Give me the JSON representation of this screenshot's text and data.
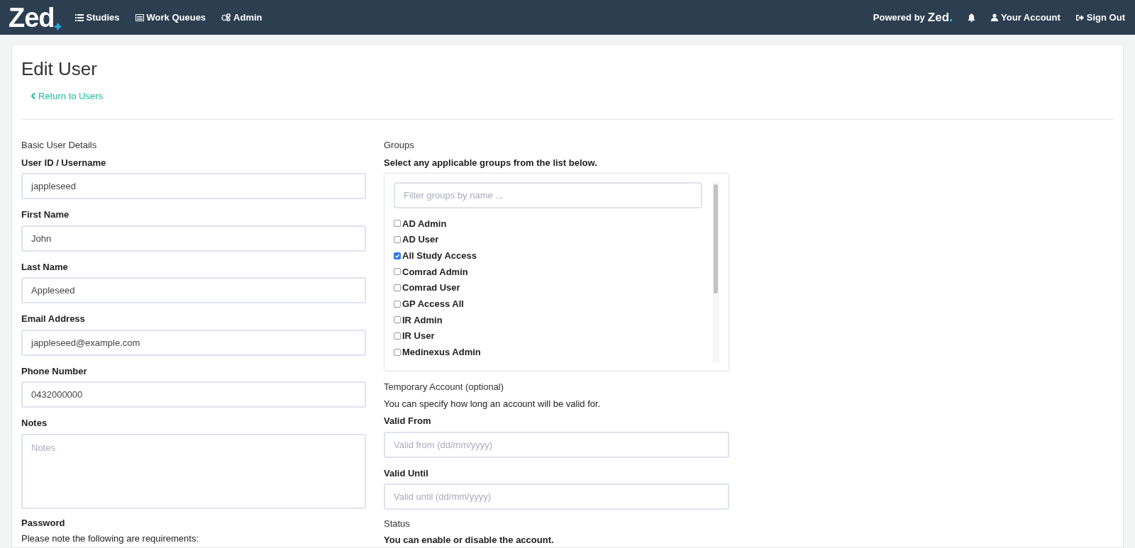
{
  "navbar": {
    "logo": "Zed",
    "menu": [
      {
        "label": "Studies",
        "kind": "list"
      },
      {
        "label": "Work Queues",
        "kind": "table"
      },
      {
        "label": "Admin",
        "kind": "gears"
      }
    ],
    "powered_by": "Powered by",
    "powered_logo": "Zed",
    "account": "Your Account",
    "sign_out": "Sign Out"
  },
  "page": {
    "title": "Edit User",
    "back_link": "Return to Users"
  },
  "basic": {
    "heading": "Basic User Details",
    "fields": [
      {
        "label": "User ID / Username",
        "value": "jappleseed"
      },
      {
        "label": "First Name",
        "value": "John"
      },
      {
        "label": "Last Name",
        "value": "Appleseed"
      },
      {
        "label": "Email Address",
        "value": "jappleseed@example.com"
      },
      {
        "label": "Phone Number",
        "value": "0432000000"
      }
    ],
    "notes": {
      "label": "Notes",
      "placeholder": "Notes"
    },
    "password": {
      "label": "Password",
      "note": "Please note the following are requirements:"
    }
  },
  "groups": {
    "heading": "Groups",
    "subtitle": "Select any applicable groups from the list below.",
    "filter": {
      "placeholder": "Filter groups by name ..."
    },
    "items": [
      {
        "label": "AD Admin",
        "checked": false
      },
      {
        "label": "AD User",
        "checked": false
      },
      {
        "label": "All Study Access",
        "checked": true
      },
      {
        "label": "Comrad Admin",
        "checked": false
      },
      {
        "label": "Comrad User",
        "checked": false
      },
      {
        "label": "GP Access All",
        "checked": false
      },
      {
        "label": "IR Admin",
        "checked": false
      },
      {
        "label": "IR User",
        "checked": false
      },
      {
        "label": "Medinexus Admin",
        "checked": false
      }
    ]
  },
  "temporary": {
    "heading": "Temporary Account (optional)",
    "text": "You can specify how long an account will be valid for.",
    "fields": [
      {
        "label": "Valid From",
        "placeholder": "Valid from (dd/mm/yyyy)"
      },
      {
        "label": "Valid Until",
        "placeholder": "Valid until (dd/mm/yyyy)"
      }
    ]
  },
  "status": {
    "heading": "Status",
    "text": "You can enable or disable the account."
  }
}
